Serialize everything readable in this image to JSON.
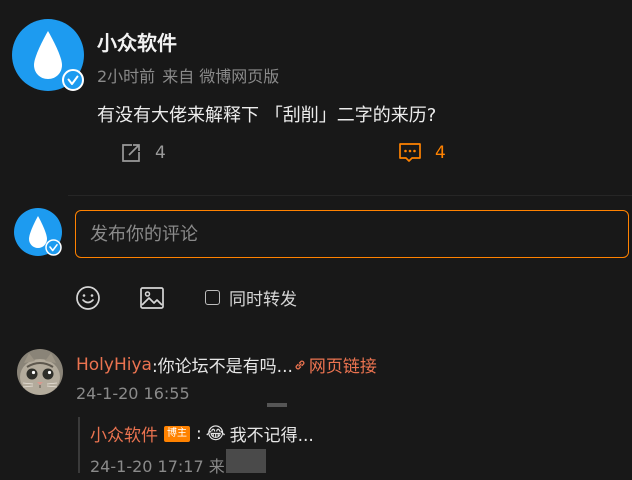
{
  "post": {
    "author": "小众软件",
    "time": "2小时前",
    "source": "来自 微博网页版",
    "text": "有没有大佬来解释下 「刮削」二字的来历?",
    "share_count": "4",
    "comment_count": "4"
  },
  "composer": {
    "placeholder": "发布你的评论",
    "repost_label": "同时转发"
  },
  "comment": {
    "user": "HolyHiya",
    "text": ":你论坛不是有吗...",
    "link_label": "网页链接",
    "time": "24-1-20 16:55"
  },
  "reply": {
    "user": "小众软件",
    "badge": "博主",
    "separator": ":",
    "emoji": "😂",
    "text": "我不记得...",
    "time": "24-1-20 17:17",
    "time_suffix": "来"
  },
  "colors": {
    "accent": "#ff8200",
    "username": "#eb7350",
    "verify": "#1d9bf0",
    "background": "#181818"
  },
  "icons": [
    "water-drop-logo-icon",
    "verified-icon",
    "share-icon",
    "comment-icon",
    "emoji-icon",
    "image-icon",
    "link-icon"
  ]
}
